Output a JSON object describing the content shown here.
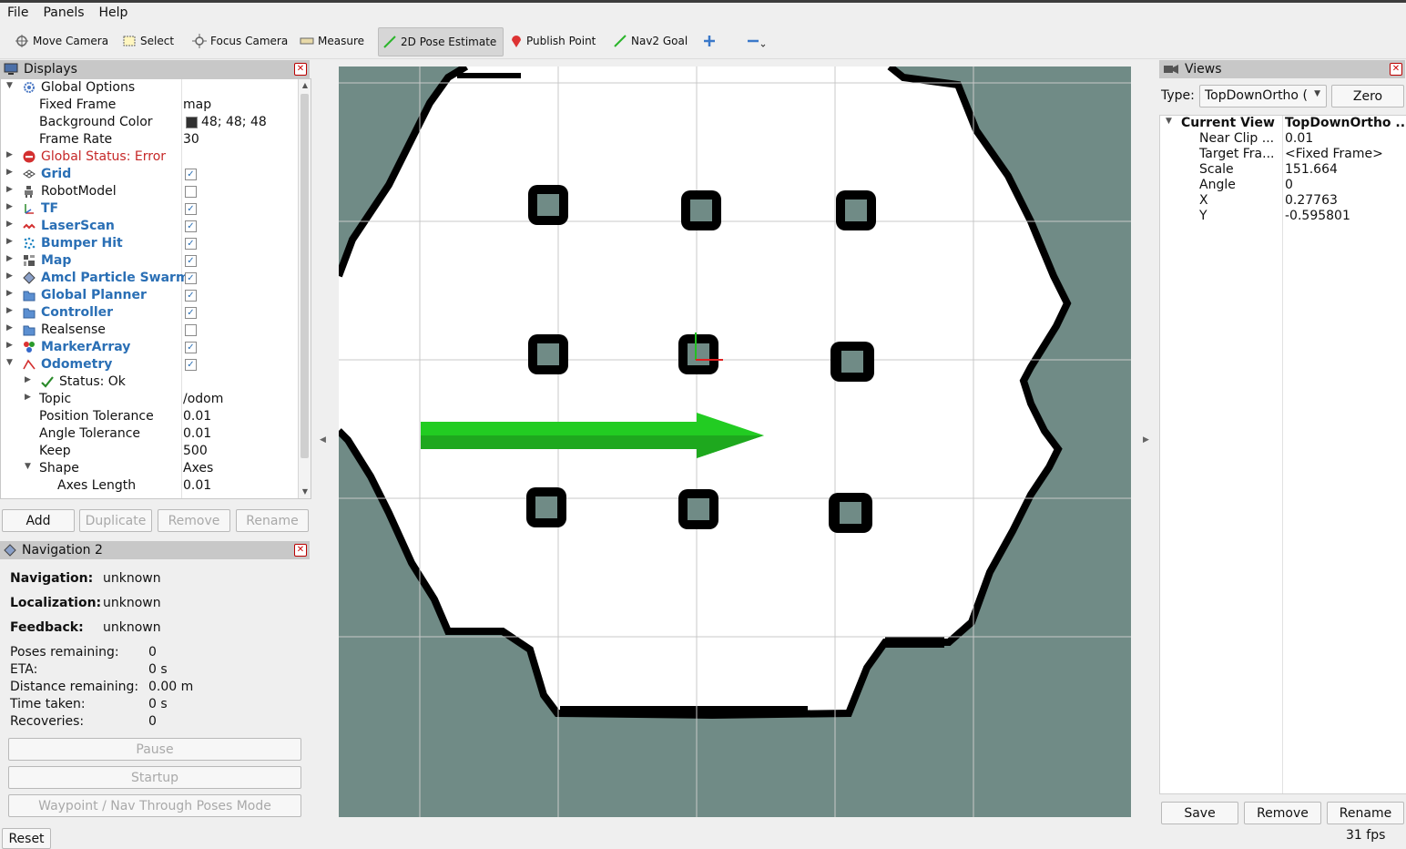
{
  "menu": [
    "File",
    "Panels",
    "Help"
  ],
  "toolbar": {
    "move_camera": "Move Camera",
    "select": "Select",
    "focus_camera": "Focus Camera",
    "measure": "Measure",
    "pose_estimate": "2D Pose Estimate",
    "publish_point": "Publish Point",
    "nav2_goal": "Nav2 Goal"
  },
  "displays": {
    "title": "Displays",
    "rows": [
      {
        "label": "Global Options",
        "value": ""
      },
      {
        "label": "Fixed Frame",
        "value": "map"
      },
      {
        "label": "Background Color",
        "value": "48; 48; 48"
      },
      {
        "label": "Frame Rate",
        "value": "30"
      },
      {
        "label": "Global Status: Error",
        "value": ""
      },
      {
        "label": "Grid",
        "checked": true
      },
      {
        "label": "RobotModel",
        "checked": false
      },
      {
        "label": "TF",
        "checked": true
      },
      {
        "label": "LaserScan",
        "checked": true
      },
      {
        "label": "Bumper Hit",
        "checked": true
      },
      {
        "label": "Map",
        "checked": true
      },
      {
        "label": "Amcl Particle Swarm",
        "checked": true
      },
      {
        "label": "Global Planner",
        "checked": true
      },
      {
        "label": "Controller",
        "checked": true
      },
      {
        "label": "Realsense",
        "checked": false
      },
      {
        "label": "MarkerArray",
        "checked": true
      },
      {
        "label": "Odometry",
        "checked": true
      },
      {
        "label": "Status: Ok",
        "value": ""
      },
      {
        "label": "Topic",
        "value": "/odom"
      },
      {
        "label": "Position Tolerance",
        "value": "0.01"
      },
      {
        "label": "Angle Tolerance",
        "value": "0.01"
      },
      {
        "label": "Keep",
        "value": "500"
      },
      {
        "label": "Shape",
        "value": "Axes"
      },
      {
        "label": "Axes Length",
        "value": "0.01"
      }
    ],
    "buttons": {
      "add": "Add",
      "duplicate": "Duplicate",
      "remove": "Remove",
      "rename": "Rename"
    }
  },
  "navigation": {
    "title": "Navigation 2",
    "navigation_label": "Navigation:",
    "navigation_value": "unknown",
    "localization_label": "Localization:",
    "localization_value": "unknown",
    "feedback_label": "Feedback:",
    "feedback_value": "unknown",
    "poses_label": "Poses remaining:",
    "poses_value": "0",
    "eta_label": "ETA:",
    "eta_value": "0 s",
    "distance_label": "Distance remaining:",
    "distance_value": "0.00 m",
    "time_label": "Time taken:",
    "time_value": "0 s",
    "recoveries_label": "Recoveries:",
    "recoveries_value": "0",
    "pause": "Pause",
    "startup": "Startup",
    "waypoint": "Waypoint / Nav Through Poses Mode"
  },
  "views": {
    "title": "Views",
    "type_label": "Type:",
    "type_value": "TopDownOrtho (",
    "zero": "Zero",
    "current_view": "Current View",
    "current_view_value": "TopDownOrtho ...",
    "props": [
      {
        "label": "Near Clip ...",
        "value": "0.01"
      },
      {
        "label": "Target Fra...",
        "value": "<Fixed Frame>"
      },
      {
        "label": "Scale",
        "value": "151.664"
      },
      {
        "label": "Angle",
        "value": "0"
      },
      {
        "label": "X",
        "value": "0.27763"
      },
      {
        "label": "Y",
        "value": "-0.595801"
      }
    ],
    "save": "Save",
    "remove": "Remove",
    "rename": "Rename"
  },
  "reset": "Reset",
  "fps": "31 fps",
  "colors": {
    "map_unknown": "#708b86",
    "map_free": "#ffffff",
    "map_wall": "#000000",
    "pose_arrow": "#22cc22",
    "grid": "#c8c8c8"
  }
}
